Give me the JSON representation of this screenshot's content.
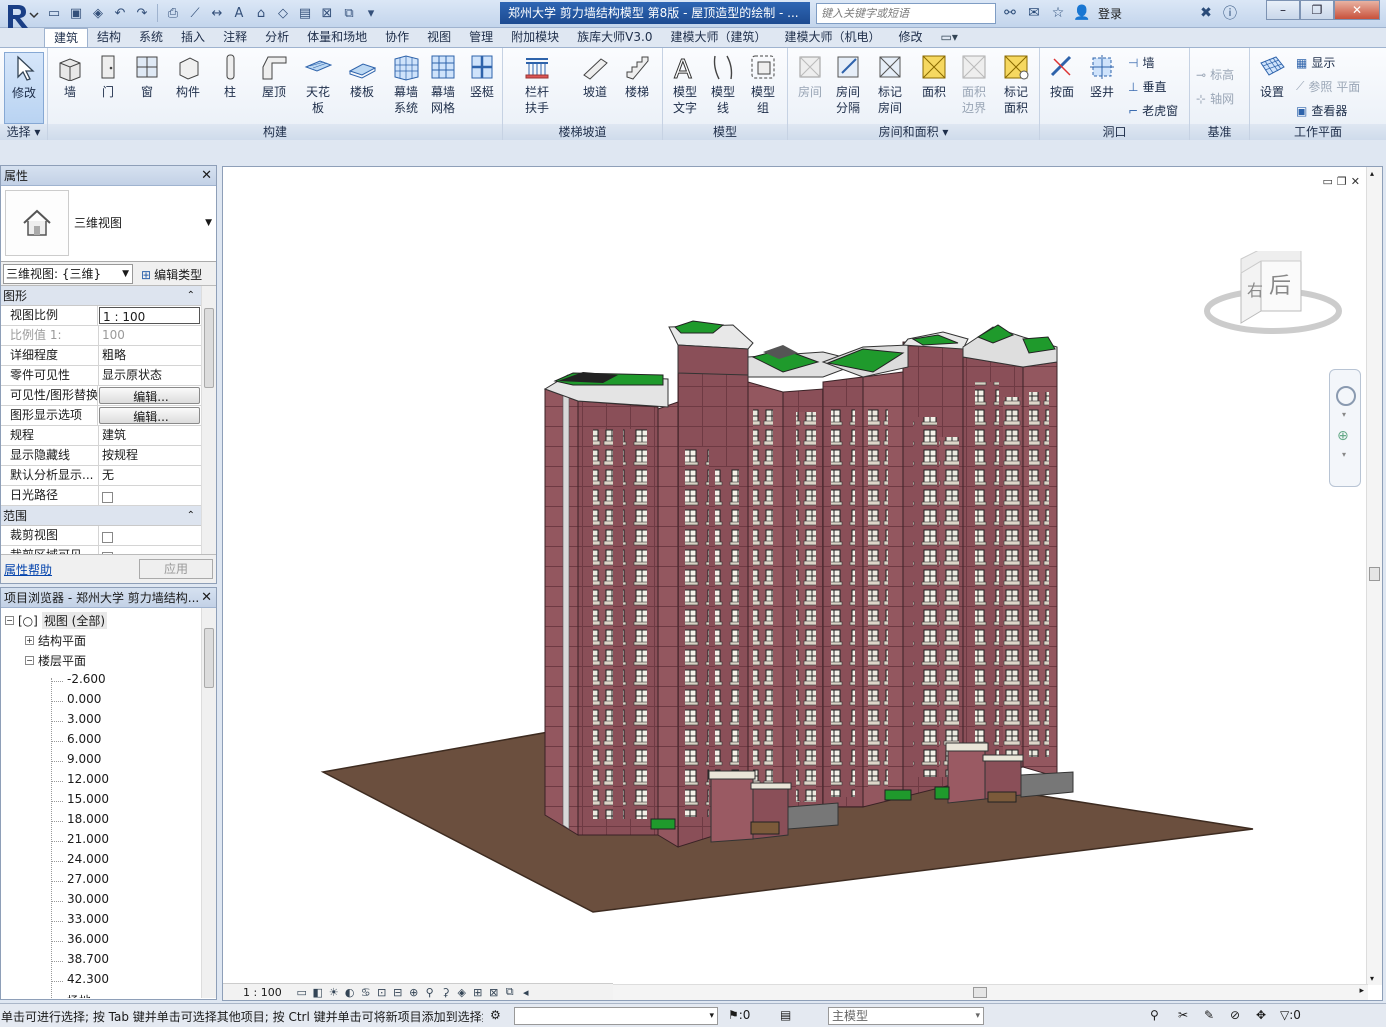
{
  "titlebar": {
    "doc_title": "郑州大学 剪力墙结构模型 第8版 - 屋顶造型的绘制 - ...",
    "search_placeholder": "键入关键字或短语",
    "login": "登录"
  },
  "tabs": [
    "建筑",
    "结构",
    "系统",
    "插入",
    "注释",
    "分析",
    "体量和场地",
    "协作",
    "视图",
    "管理",
    "附加模块",
    "族库大师V3.0",
    "建模大师（建筑）",
    "建模大师（机电）",
    "修改"
  ],
  "active_tab": "建筑",
  "ribbon": {
    "select": {
      "button": "修改",
      "label": "选择"
    },
    "build": {
      "label": "构建",
      "buttons": [
        "墙",
        "门",
        "窗",
        "构件",
        "柱",
        "屋顶",
        "天花板",
        "楼板",
        "幕墙系统",
        "幕墙网格",
        "竖梃"
      ]
    },
    "circulation": {
      "label": "楼梯坡道",
      "buttons": [
        "栏杆扶手",
        "坡道",
        "楼梯"
      ]
    },
    "model": {
      "label": "模型",
      "buttons": [
        "模型文字",
        "模型线",
        "模型组"
      ]
    },
    "room_area": {
      "label": "房间和面积",
      "buttons": [
        "房间",
        "房间分隔",
        "标记房间",
        "面积",
        "面积边界",
        "标记面积"
      ]
    },
    "opening": {
      "label": "洞口",
      "buttons": [
        "按面",
        "竖井"
      ],
      "small": [
        "墙",
        "垂直",
        "老虎窗"
      ]
    },
    "datum": {
      "label": "基准",
      "small": [
        "标高",
        "轴网"
      ]
    },
    "workplane": {
      "label": "工作平面",
      "buttons": [
        "设置"
      ],
      "small": [
        "显示",
        "参照 平面",
        "查看器"
      ]
    }
  },
  "properties": {
    "title": "属性",
    "type_name": "三维视图",
    "view_select": "三维视图: {三维}",
    "edit_type": "编辑类型",
    "cat_graphics": "图形",
    "cat_extents": "范围",
    "rows": [
      {
        "k": "视图比例",
        "v": "1 : 100"
      },
      {
        "k": "比例值 1:",
        "v": "100"
      },
      {
        "k": "详细程度",
        "v": "粗略"
      },
      {
        "k": "零件可见性",
        "v": "显示原状态"
      },
      {
        "k": "可见性/图形替换",
        "v": "编辑..."
      },
      {
        "k": "图形显示选项",
        "v": "编辑..."
      },
      {
        "k": "规程",
        "v": "建筑"
      },
      {
        "k": "显示隐藏线",
        "v": "按规程"
      },
      {
        "k": "默认分析显示...",
        "v": "无"
      },
      {
        "k": "日光路径",
        "v": ""
      }
    ],
    "extent_rows": [
      {
        "k": "裁剪视图",
        "v": ""
      },
      {
        "k": "裁剪区域可见",
        "v": ""
      }
    ],
    "help": "属性帮助",
    "apply": "应用"
  },
  "browser": {
    "title": "项目浏览器 - 郑州大学 剪力墙结构...",
    "root": "视图 (全部)",
    "structural": "结构平面",
    "floor": "楼层平面",
    "levels": [
      "-2.600",
      "0.000",
      "3.000",
      "6.000",
      "9.000",
      "12.000",
      "15.000",
      "18.000",
      "21.000",
      "24.000",
      "27.000",
      "30.000",
      "33.000",
      "36.000",
      "38.700",
      "42.300",
      "场地"
    ]
  },
  "viewport": {
    "scale": "1 : 100",
    "viewcube_left": "右",
    "viewcube_right": "后"
  },
  "status": {
    "text": "单击可进行选择; 按 Tab 键并单击可选择其他项目; 按 Ctrl 键并单击可将新项目添加到选择集",
    "count": ":0",
    "model": "主模型",
    "filter": ":0"
  },
  "colors": {
    "facade": "#8a4f58",
    "ground": "#6b4f3e",
    "roof_green": "#1f9a2c",
    "title_accent": "#1d4b91"
  }
}
